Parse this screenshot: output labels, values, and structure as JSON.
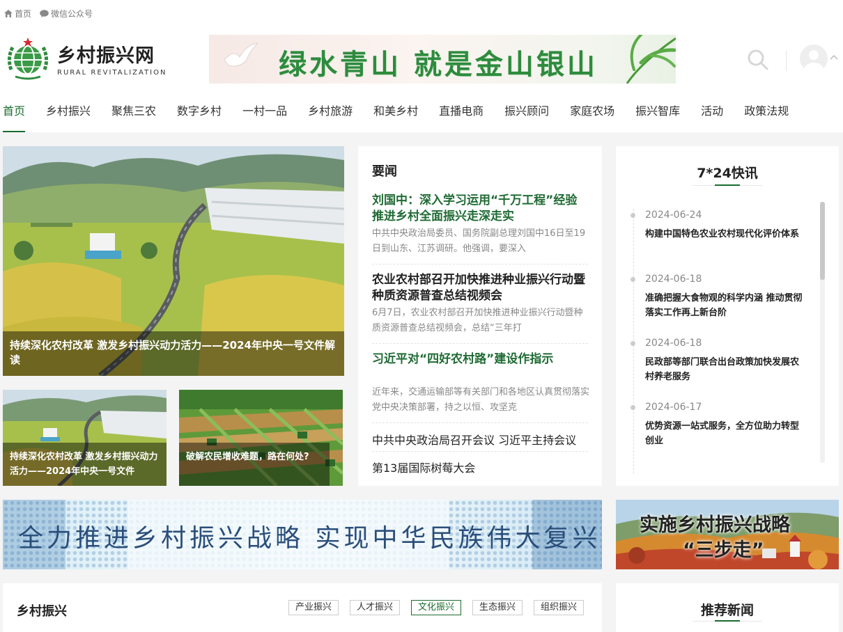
{
  "toplinks": {
    "home": "首页",
    "wechat": "微信公众号"
  },
  "logo": {
    "cn": "乡村振兴网",
    "en": "RURAL  REVITALIZATION"
  },
  "header_banner": {
    "text": "绿水青山 就是金山银山"
  },
  "nav": [
    "首页",
    "乡村振兴",
    "聚焦三农",
    "数字乡村",
    "一村一品",
    "乡村旅游",
    "和美乡村",
    "直播电商",
    "振兴顾问",
    "家庭农场",
    "振兴智库",
    "活动",
    "政策法规"
  ],
  "hero": {
    "caption": "持续深化农村改革 激发乡村振兴动力活力——2024年中央一号文件解读"
  },
  "thumbs": [
    {
      "caption": "持续深化农村改革 激发乡村振兴动力活力——2024年中央一号文件"
    },
    {
      "caption": "破解农民增收难题，路在何处?"
    }
  ],
  "news": {
    "title": "要闻",
    "items": [
      {
        "title": "刘国中：深入学习运用“千万工程”经验 推进乡村全面振兴走深走实",
        "summary": "中共中央政治局委员、国务院副总理刘国中16日至19日到山东、江苏调研。他强调，要深入"
      },
      {
        "title": "农业农村部召开加快推进种业振兴行动暨种质资源普查总结视频会",
        "summary": "6月7日，农业农村部召开加快推进种业振兴行动暨种质资源普查总结视频会，总结“三年打"
      },
      {
        "title": "习近平对“四好农村路”建设作指示",
        "summary": "近年来，交通运输部等有关部门和各地区认真贯彻落实党中央决策部署，持之以恒、攻坚克"
      }
    ],
    "links": [
      "中共中央政治局召开会议 习近平主持会议",
      "第13届国际树莓大会"
    ]
  },
  "flash": {
    "title": "7*24快讯",
    "items": [
      {
        "date": "2024-06-24",
        "text": "构建中国特色农业农村现代化评价体系"
      },
      {
        "date": "2024-06-18",
        "text": "准确把握大食物观的科学内涵 推动贯彻落实工作再上新台阶"
      },
      {
        "date": "2024-06-18",
        "text": "民政部等部门联合出台政策加快发展农村养老服务"
      },
      {
        "date": "2024-06-17",
        "text": "优势资源一站式服务，全方位助力转型创业"
      }
    ]
  },
  "banner_wide": {
    "text": "全力推进乡村振兴战略  实现中华民族伟大复兴"
  },
  "banner_side": {
    "line1": "实施乡村振兴战略",
    "line2": "“三步走”"
  },
  "section": {
    "title": "乡村振兴",
    "chips": [
      "产业振兴",
      "人才振兴",
      "文化振兴",
      "生态振兴",
      "组织振兴"
    ],
    "active_chip": 2
  },
  "recommend": {
    "title": "推荐新闻"
  },
  "colors": {
    "brand_green": "#1a6b2e",
    "title_green": "#1f6b34"
  }
}
